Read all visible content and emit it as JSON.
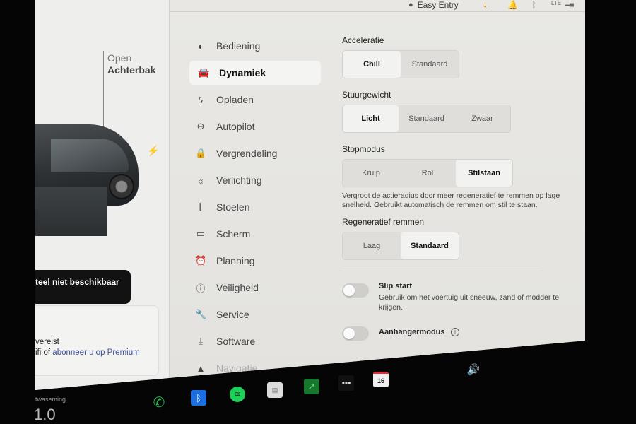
{
  "status_bar": {
    "profile_icon": "person-icon",
    "profile_name": "Easy Entry",
    "icons": [
      "download-icon",
      "bell-icon",
      "bluetooth-icon",
      "lte-signal-icon"
    ],
    "lte_label": "LTE"
  },
  "car_panel": {
    "trunk_line1": "Open",
    "trunk_line2": "Achterbak",
    "charge_icon": "⚡",
    "toast_text": "teel niet beschikbaar",
    "premium_line1": "vereist",
    "premium_line2_prefix": "ifi of ",
    "premium_link": "abonneer u op Premium"
  },
  "menu": {
    "items": [
      {
        "label": "Bediening",
        "icon": "toggle-icon",
        "glyph": "◐"
      },
      {
        "label": "Dynamiek",
        "icon": "car-icon",
        "glyph": "🚘",
        "active": true
      },
      {
        "label": "Opladen",
        "icon": "lightning-icon",
        "glyph": "ϟ"
      },
      {
        "label": "Autopilot",
        "icon": "steering-wheel-icon",
        "glyph": "⊖"
      },
      {
        "label": "Vergrendeling",
        "icon": "lock-icon",
        "glyph": "🔒"
      },
      {
        "label": "Verlichting",
        "icon": "light-icon",
        "glyph": "☼"
      },
      {
        "label": "Stoelen",
        "icon": "seat-icon",
        "glyph": "⌊"
      },
      {
        "label": "Scherm",
        "icon": "display-icon",
        "glyph": "▭"
      },
      {
        "label": "Planning",
        "icon": "alarm-clock-icon",
        "glyph": "⏰"
      },
      {
        "label": "Veiligheid",
        "icon": "alert-circle-icon",
        "glyph": "ⓘ"
      },
      {
        "label": "Service",
        "icon": "wrench-icon",
        "glyph": "🔧"
      },
      {
        "label": "Software",
        "icon": "download-icon",
        "glyph": "⤓"
      },
      {
        "label": "Navigatie",
        "icon": "navigation-icon",
        "glyph": "▲",
        "faded": true
      }
    ]
  },
  "options": {
    "acceleratie": {
      "label": "Acceleratie",
      "options": [
        "Chill",
        "Standaard"
      ],
      "selected": "Chill"
    },
    "stuurgewicht": {
      "label": "Stuurgewicht",
      "options": [
        "Licht",
        "Standaard",
        "Zwaar"
      ],
      "selected": "Licht"
    },
    "stopmodus": {
      "label": "Stopmodus",
      "options": [
        "Kruip",
        "Rol",
        "Stilstaan"
      ],
      "selected": "Stilstaan",
      "description": "Vergroot de actieradius door meer regeneratief te remmen op lage snelheid. Gebruikt automatisch de remmen om stil te staan."
    },
    "regeneratief": {
      "label": "Regeneratief remmen",
      "options": [
        "Laag",
        "Standaard"
      ],
      "selected": "Standaard"
    },
    "slip_start": {
      "title": "Slip start",
      "description": "Gebruik om het voertuig uit sneeuw, zand of modder te krijgen.",
      "on": false
    },
    "aanhanger": {
      "title": "Aanhangermodus",
      "on": false,
      "info_icon": "i"
    }
  },
  "dock": {
    "climate_label": "twaseming",
    "climate_value": "1.0",
    "icons": [
      {
        "name": "phone-icon",
        "glyph": "✆"
      },
      {
        "name": "bluetooth-icon",
        "glyph": "ᛒ"
      },
      {
        "name": "spotify-icon",
        "glyph": "≋"
      },
      {
        "name": "radio-icon",
        "glyph": "▤"
      },
      {
        "name": "stocks-icon",
        "glyph": "↗"
      },
      {
        "name": "more-icon",
        "glyph": "•••"
      },
      {
        "name": "calendar-icon",
        "glyph": "16"
      },
      {
        "name": "volume-icon",
        "glyph": "🔊"
      }
    ]
  }
}
